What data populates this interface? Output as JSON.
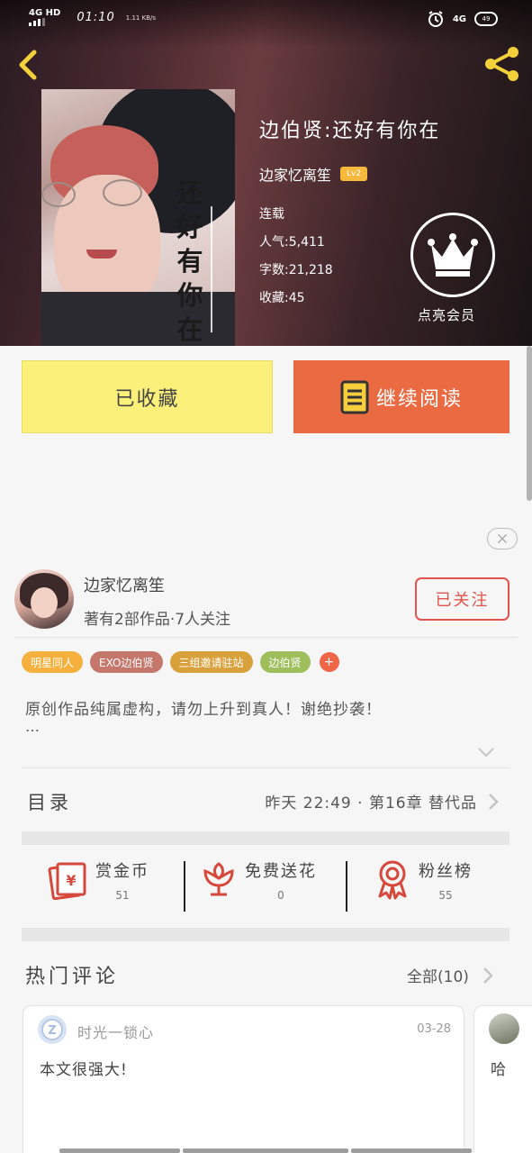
{
  "status_bar": {
    "network_left": "4G HD",
    "time": "01:10",
    "speed": "1.11 KB/s",
    "network_right": "4G",
    "battery": "49"
  },
  "book": {
    "cover_title": "还好有你在",
    "title": "边伯贤:还好有你在",
    "author": "边家忆离笙",
    "level": "Lv2",
    "status": "连载",
    "popularity": "人气:5,411",
    "word_count": "字数:21,218",
    "favorites": "收藏:45"
  },
  "vip": {
    "label": "点亮会员"
  },
  "actions": {
    "favorite_label": "已收藏",
    "read_label": "继续阅读"
  },
  "author_card": {
    "name": "边家忆离笙",
    "subtitle": "著有2部作品·7人关注",
    "follow_label": "已关注"
  },
  "tags": [
    {
      "label": "明星同人",
      "color": "#f6b03d"
    },
    {
      "label": "EXO边伯贤",
      "color": "#c5776c"
    },
    {
      "label": "三组邀请驻站",
      "color": "#d9a13b"
    },
    {
      "label": "边伯贤",
      "color": "#9ebf5c"
    }
  ],
  "tag_more": "+",
  "description": {
    "text": "原创作品纯属虚构，请勿上升到真人！谢绝抄袭！",
    "more": "…"
  },
  "catalog": {
    "label": "目录",
    "latest": "昨天 22:49 · 第16章  替代品"
  },
  "rewards": [
    {
      "label": "赏金币",
      "count": "51",
      "icon": "red-envelope-icon"
    },
    {
      "label": "免费送花",
      "count": "0",
      "icon": "flower-icon"
    },
    {
      "label": "粉丝榜",
      "count": "55",
      "icon": "medal-icon"
    }
  ],
  "comments": {
    "title": "热门评论",
    "all_label": "全部(10)",
    "items": [
      {
        "user": "时光一锁心",
        "date": "03-28",
        "text": "本文很强大!"
      },
      {
        "user": "",
        "date": "",
        "text": "哈"
      }
    ]
  },
  "colors": {
    "accent_orange": "#ea6b42",
    "fav_yellow": "#fbf07a",
    "follow_red": "#e0544c",
    "level_badge": "#f6b93b"
  }
}
